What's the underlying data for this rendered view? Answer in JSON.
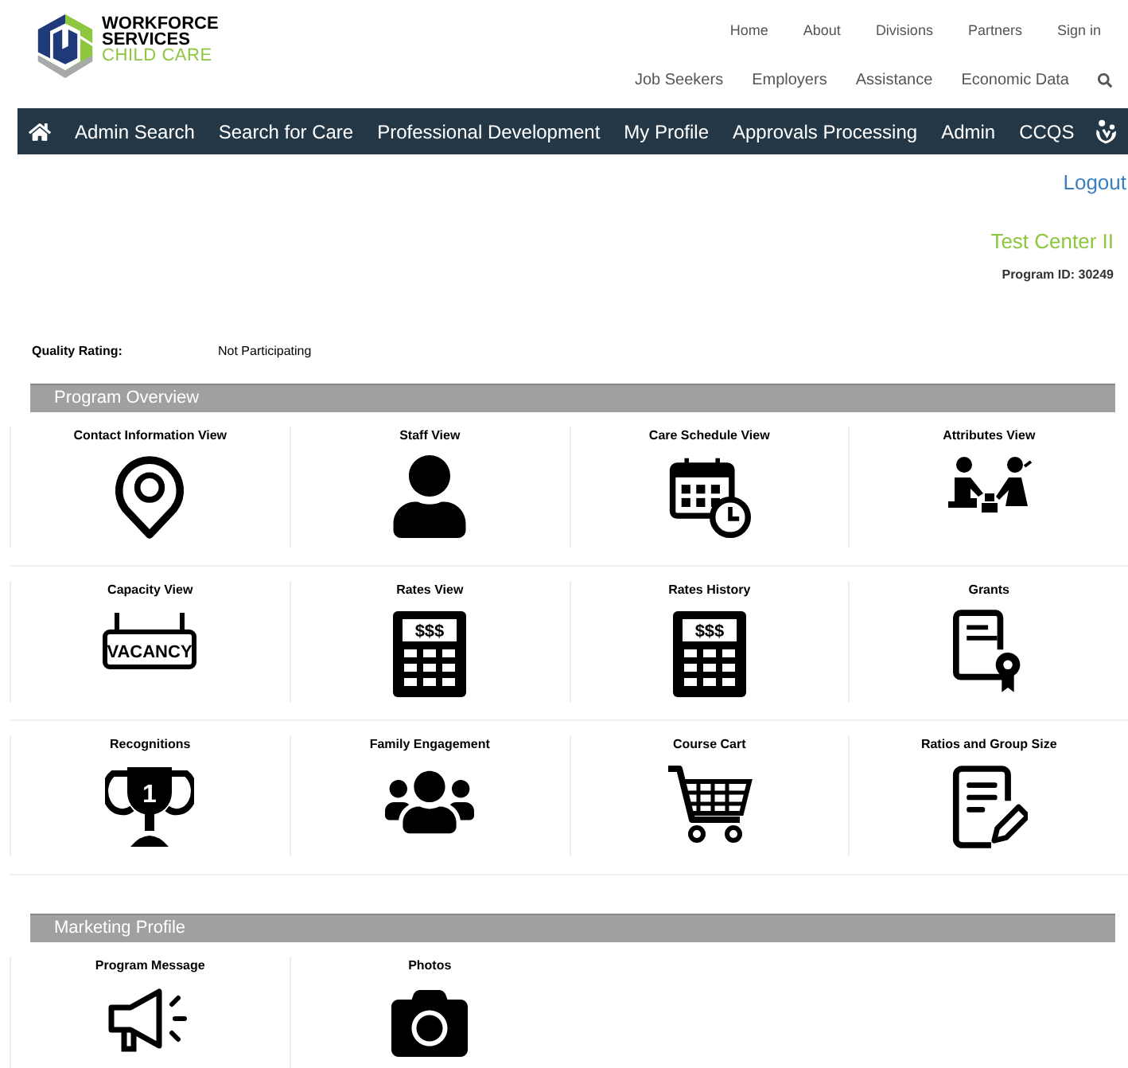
{
  "header": {
    "logo": {
      "line1": "WORKFORCE",
      "line2": "SERVICES",
      "line3": "CHILD CARE"
    },
    "top_links": [
      "Home",
      "About",
      "Divisions",
      "Partners",
      "Sign in"
    ],
    "main_links": [
      "Job Seekers",
      "Employers",
      "Assistance",
      "Economic Data"
    ]
  },
  "nav": [
    "Admin Search",
    "Search for Care",
    "Professional Development",
    "My Profile",
    "Approvals Processing",
    "Admin",
    "CCQS"
  ],
  "logout": "Logout",
  "program": {
    "name": "Test Center II",
    "id": "Program ID: 30249"
  },
  "quality": {
    "label": "Quality Rating:",
    "value": "Not Participating"
  },
  "sections": [
    {
      "title": "Program Overview",
      "tiles": [
        {
          "label": "Contact Information View"
        },
        {
          "label": "Staff View"
        },
        {
          "label": "Care Schedule View"
        },
        {
          "label": "Attributes View"
        },
        {
          "label": "Capacity View",
          "icon_text": "VACANCY"
        },
        {
          "label": "Rates View",
          "icon_text": "$$$"
        },
        {
          "label": "Rates History",
          "icon_text": "$$$"
        },
        {
          "label": "Grants"
        },
        {
          "label": "Recognitions",
          "icon_text": "1"
        },
        {
          "label": "Family Engagement"
        },
        {
          "label": "Course Cart"
        },
        {
          "label": "Ratios and Group Size"
        }
      ]
    },
    {
      "title": "Marketing Profile",
      "tiles": [
        {
          "label": "Program Message"
        },
        {
          "label": "Photos"
        }
      ]
    }
  ]
}
